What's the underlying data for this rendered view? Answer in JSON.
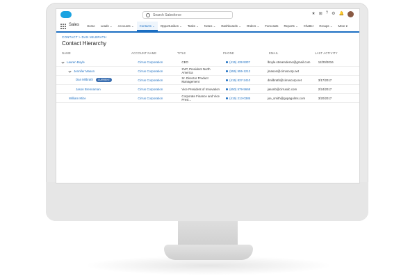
{
  "app": {
    "name": "Sales",
    "search_placeholder": "Search Salesforce"
  },
  "nav": {
    "items": [
      {
        "label": "Home"
      },
      {
        "label": "Leads ⌄"
      },
      {
        "label": "Accounts ⌄"
      },
      {
        "label": "Contacts ⌄",
        "active": true
      },
      {
        "label": "Opportunities ⌄"
      },
      {
        "label": "Tasks ⌄"
      },
      {
        "label": "Notes ⌄"
      },
      {
        "label": "Dashboards ⌄"
      },
      {
        "label": "Orders ⌄"
      },
      {
        "label": "Forecasts"
      },
      {
        "label": "Reports ⌄"
      },
      {
        "label": "Chatter"
      },
      {
        "label": "Groups ⌄"
      },
      {
        "label": "More ▾"
      }
    ]
  },
  "page": {
    "breadcrumb": "Contact > Dan Milbrath",
    "title": "Contact Hierarchy"
  },
  "table": {
    "headers": [
      "Name",
      "Account Name",
      "Title",
      "Phone",
      "Email",
      "Last Activity"
    ],
    "rows": [
      {
        "name": "Lauren Boyle",
        "indent": 0,
        "expand": true,
        "account": "Cirrus Corporation",
        "title": "CEO",
        "phone": "(415) 439 9307",
        "email": "lboyle.streamdemo@gmail.com",
        "last": "12/20/2016"
      },
      {
        "name": "Jennifer Mason",
        "indent": 1,
        "expand": true,
        "account": "Cirrus Corporation",
        "title": "SVP, President North America",
        "phone": "(555) 555-1212",
        "email": "jmason@cirruscorp.net",
        "last": ""
      },
      {
        "name": "Dan Milbrath",
        "indent": 2,
        "badge": "CURRENT",
        "account": "Cirrus Corporation",
        "title": "Sr. Director Product Management",
        "phone": "(415) 837-2410",
        "email": "dmilbrath@cirruscorp.net",
        "last": "3/17/2017"
      },
      {
        "name": "Jason Brennaman",
        "indent": 2,
        "account": "Cirrus Corporation",
        "title": "Vice President of Innovation",
        "phone": "(650) 579-5668",
        "email": "jasonb@cirrusdc.com",
        "last": "2/24/2017"
      },
      {
        "name": "William Mize",
        "indent": 1,
        "account": "Cirrus Corporation",
        "title": "Corporate Finance and Vice Presi...",
        "phone": "(415) 213-0385",
        "email": "joe_smith@gopagolms.com",
        "last": "3/20/2017"
      }
    ]
  },
  "colors": {
    "brand_blue": "#1b6ec2",
    "cloud": "#1ba3e1"
  }
}
